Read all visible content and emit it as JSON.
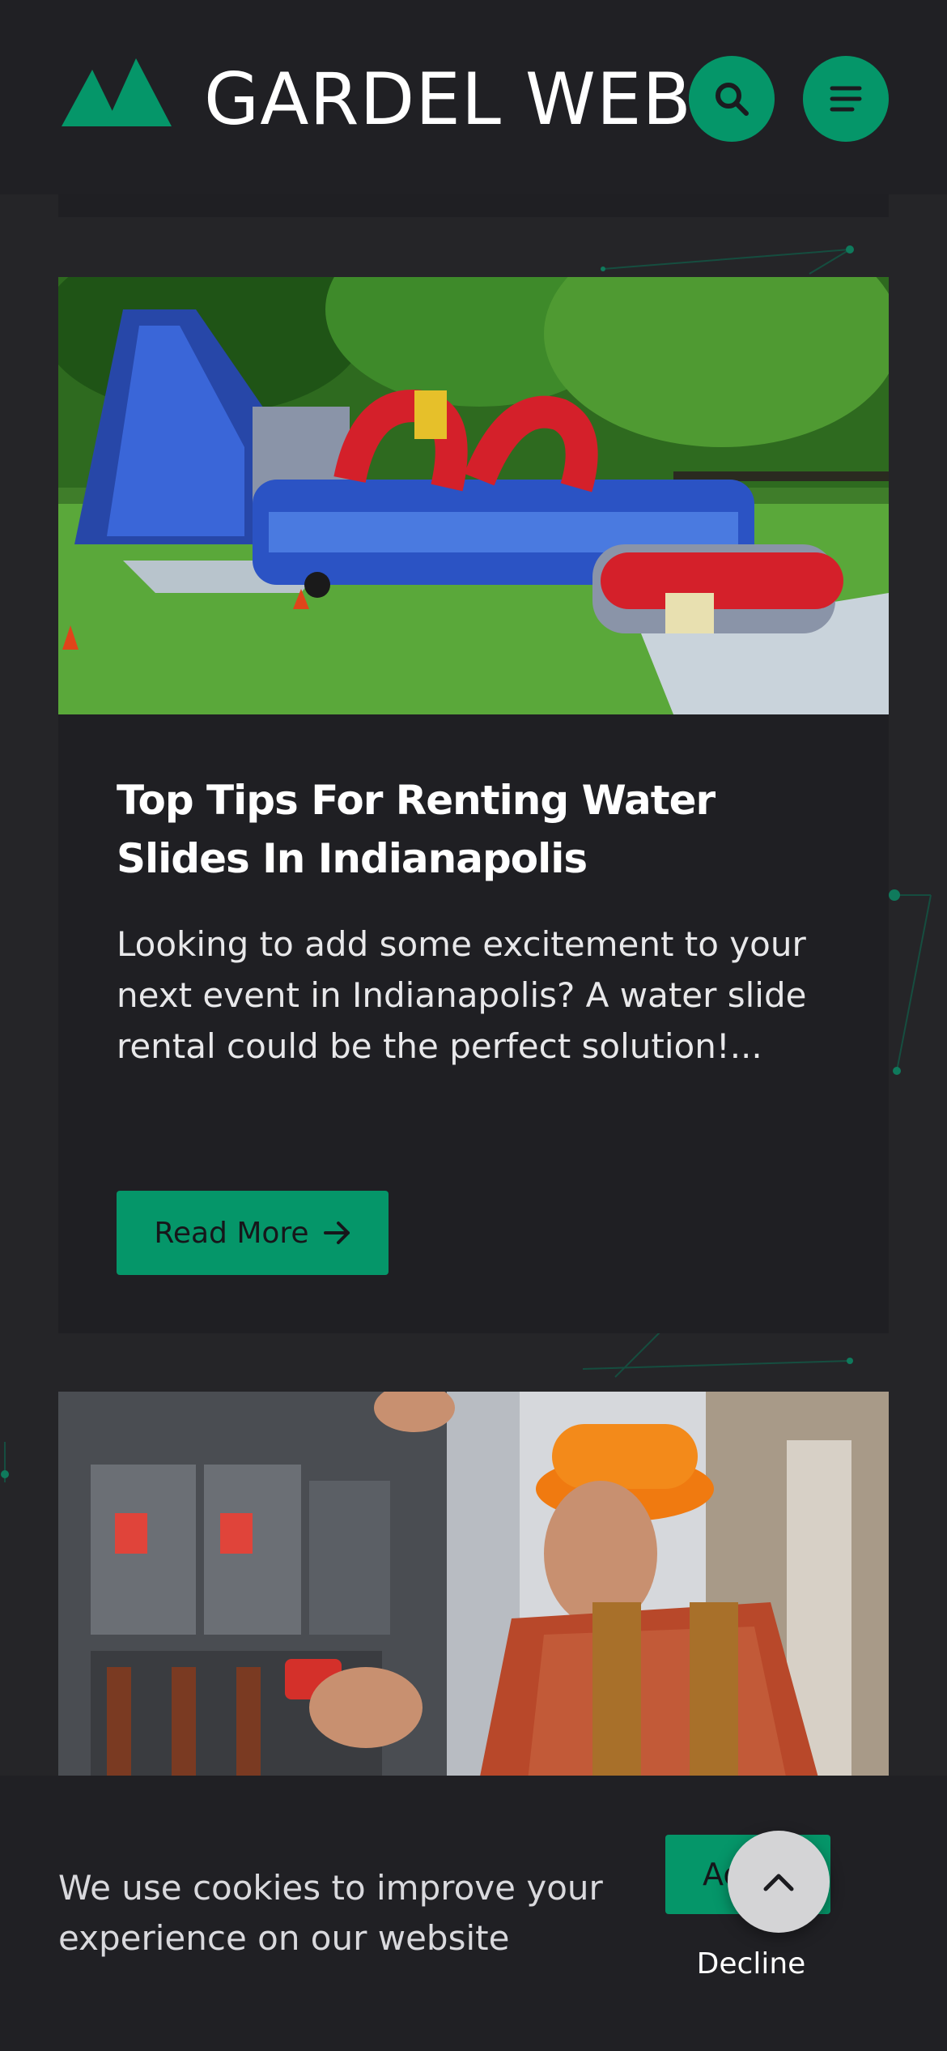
{
  "header": {
    "site_title": "GARDEL WEB",
    "logo_icon": "mountain-logo-icon",
    "search_icon": "search-icon",
    "menu_icon": "menu-icon",
    "accent_color": "#059669"
  },
  "posts": [
    {
      "image": "water-slide-photo",
      "title": "Top Tips For Renting Water Slides In Indianapolis",
      "excerpt": "Looking to add some excitement to your next event in Indianapolis? A water slide rental could be the perfect solution!...",
      "read_more_label": "Read More",
      "read_more_icon": "arrow-right-icon"
    },
    {
      "image": "electrician-photo"
    }
  ],
  "cookie_banner": {
    "message": "We use cookies to improve your experience on our website",
    "accept_label": "Accept",
    "decline_label": "Decline"
  },
  "scroll_top_icon": "chevron-up-icon"
}
